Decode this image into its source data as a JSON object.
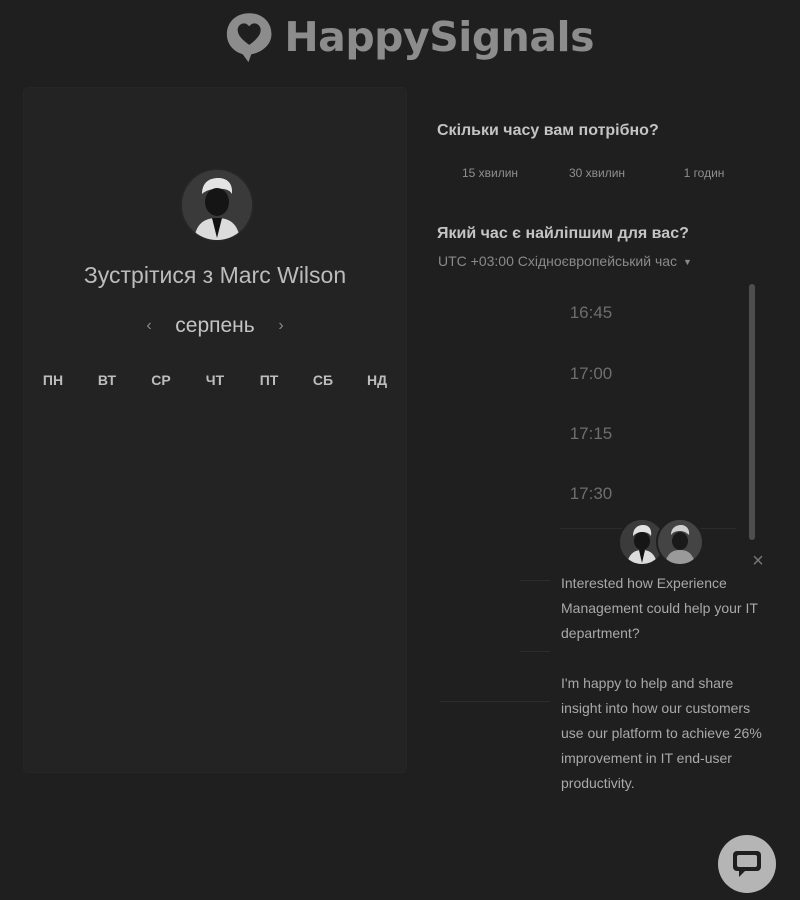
{
  "brand": {
    "name": "HappySignals",
    "logo_icon": "heart-speech-bubble-icon"
  },
  "scheduler": {
    "meet_prefix": "Зустрітися з",
    "host_name": "Marc Wilson",
    "month": "серпень",
    "weekdays": [
      "ПН",
      "ВТ",
      "СР",
      "ЧТ",
      "ПТ",
      "СБ",
      "НД"
    ],
    "duration_question": "Скільки часу вам потрібно?",
    "durations": [
      "15 хвилин",
      "30 хвилин",
      "1 годин"
    ],
    "time_question": "Який час є найліпшим для вас?",
    "timezone": "UTC +03:00 Східноєвропейський час",
    "time_slots": [
      "16:45",
      "17:00",
      "17:15",
      "17:30"
    ]
  },
  "chat": {
    "message_1": "Interested how Experience Management could help your IT department?",
    "message_2": "I'm happy to help and share insight into how our customers use our platform to achieve 26% improvement in IT end-user productivity.",
    "close_icon": "close-icon",
    "launcher_icon": "chat-bubble-icon"
  },
  "colors": {
    "background": "#1f1f1f",
    "panel": "#232323",
    "launcher": "#b5b5b5"
  }
}
